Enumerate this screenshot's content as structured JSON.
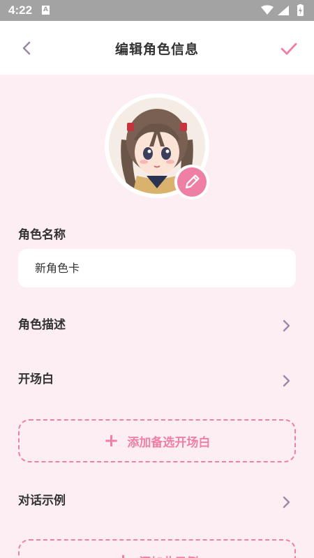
{
  "status_bar": {
    "time": "4:22",
    "notification_badge": "A"
  },
  "app_bar": {
    "title": "编辑角色信息"
  },
  "form": {
    "name_label": "角色名称",
    "name_value": "新角色卡",
    "description_label": "角色描述",
    "opening_label": "开场白",
    "add_alt_opening": "添加备选开场白",
    "examples_label": "对话示例",
    "add_example": "添加此示例"
  },
  "colors": {
    "accent": "#f07fa5",
    "background": "#fdeef4",
    "status_bar": "#a3a3a3"
  },
  "icons": [
    "back-chevron-icon",
    "check-icon",
    "pencil-icon",
    "chevron-right-icon",
    "plus-icon",
    "wifi-icon",
    "signal-icon",
    "battery-icon"
  ]
}
